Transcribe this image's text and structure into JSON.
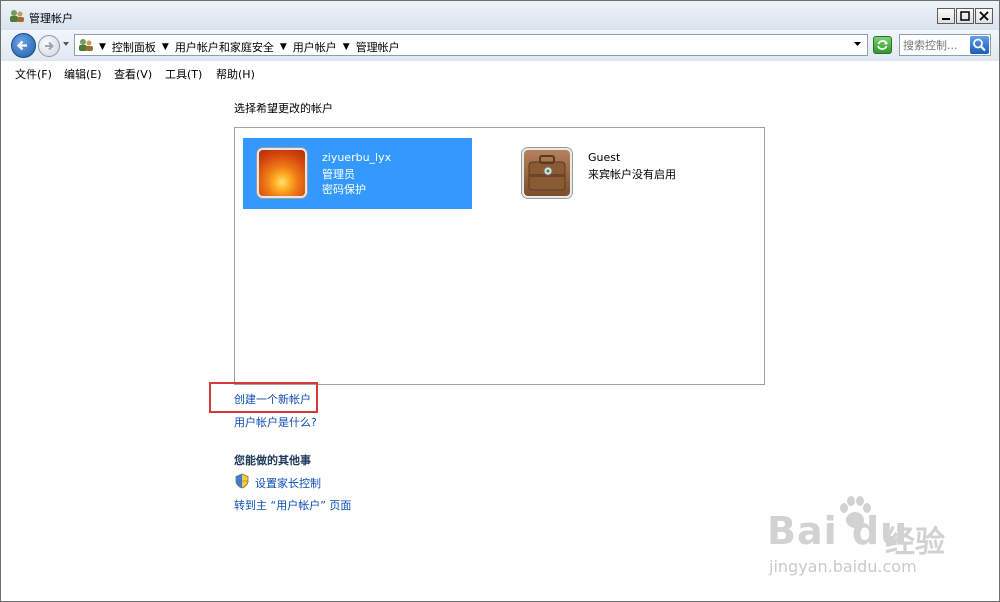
{
  "window": {
    "title": "管理帐户",
    "minimize": "_",
    "maximize": "□",
    "close": "X"
  },
  "nav": {
    "breadcrumbs": [
      "控制面板",
      "用户帐户和家庭安全",
      "用户帐户",
      "管理帐户"
    ],
    "search_placeholder": "搜索控制..."
  },
  "menu": [
    "文件(F)",
    "编辑(E)",
    "查看(V)",
    "工具(T)",
    "帮助(H)"
  ],
  "content": {
    "heading": "选择希望更改的帐户",
    "accounts": [
      {
        "name": "ziyuerbu_lyx",
        "lines": [
          "管理员",
          "密码保护"
        ],
        "selected": true
      },
      {
        "name": "Guest",
        "lines": [
          "来宾帐户没有启用"
        ],
        "selected": false
      }
    ],
    "create_link": "创建一个新帐户",
    "what_link": "用户帐户是什么?",
    "other_title": "您能做的其他事",
    "parental_link": "设置家长控制",
    "main_link": "转到主 “用户帐户” 页面"
  },
  "watermark": {
    "main": "Bai du",
    "cn": "经验",
    "url": "jingyan.baidu.com"
  },
  "colors": {
    "selection": "#3399ff",
    "link": "#0b4fb4",
    "highlight_box": "#d43a3a"
  }
}
